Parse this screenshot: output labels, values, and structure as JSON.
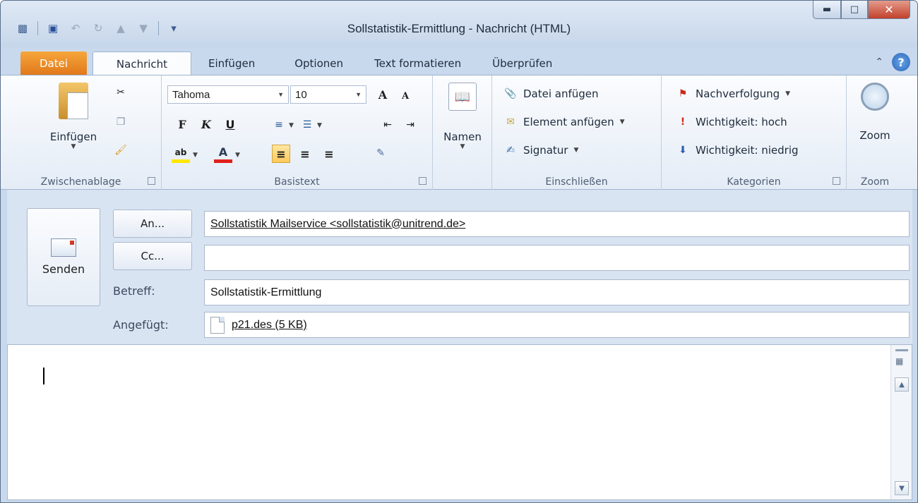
{
  "window": {
    "title": "Sollstatistik-Ermittlung  -  Nachricht (HTML)"
  },
  "qat": {
    "more": "▾"
  },
  "tabs": [
    {
      "label": "Datei"
    },
    {
      "label": "Nachricht"
    },
    {
      "label": "Einfügen"
    },
    {
      "label": "Optionen"
    },
    {
      "label": "Text formatieren"
    },
    {
      "label": "Überprüfen"
    }
  ],
  "help": {
    "label": "?"
  },
  "ribbon": {
    "clipboard": {
      "group_label": "Zwischenablage",
      "paste_label": "Einfügen"
    },
    "basic_text": {
      "group_label": "Basistext",
      "font_name": "Tahoma",
      "font_size": "10",
      "bold": "F",
      "italic": "K",
      "underline": "U"
    },
    "names": {
      "label": "Namen"
    },
    "include": {
      "group_label": "Einschließen",
      "attach_file": "Datei anfügen",
      "attach_item": "Element anfügen",
      "signature": "Signatur"
    },
    "tags": {
      "group_label": "Kategorien",
      "follow_up": "Nachverfolgung",
      "high_importance": "Wichtigkeit: hoch",
      "low_importance": "Wichtigkeit: niedrig"
    },
    "zoom": {
      "group_label": "Zoom",
      "label": "Zoom"
    }
  },
  "compose": {
    "send_label": "Senden",
    "to_button": "An...",
    "cc_button": "Cc...",
    "subject_label": "Betreff:",
    "attached_label": "Angefügt:",
    "to_value": "Sollstatistik Mailservice <sollstatistik@unitrend.de>",
    "cc_value": "",
    "subject_value": "Sollstatistik-Ermittlung",
    "attachment": "p21.des (5 KB)"
  }
}
